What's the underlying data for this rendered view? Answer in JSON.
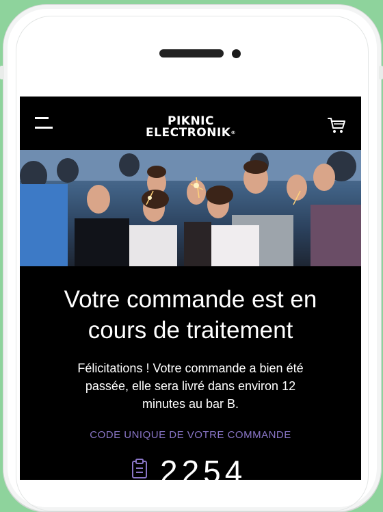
{
  "app": {
    "logo_line1": "PIKNIC",
    "logo_line2": "ELECTRONIK",
    "logo_mark": "®"
  },
  "icons": {
    "menu": "menu-icon",
    "cart": "cart-icon",
    "clipboard": "clipboard-icon"
  },
  "colors": {
    "page_background": "#8ed39c",
    "screen_background": "#000000",
    "accent_label": "#8a76c8"
  },
  "order": {
    "title": "Votre commande est en cours de traitement",
    "message": "Félicitations ! Votre commande a bien été passée, elle sera livré dans environ 12 minutes au bar B.",
    "code_label": "CODE UNIQUE DE VOTRE COMMANDE",
    "code_value": "2254"
  }
}
